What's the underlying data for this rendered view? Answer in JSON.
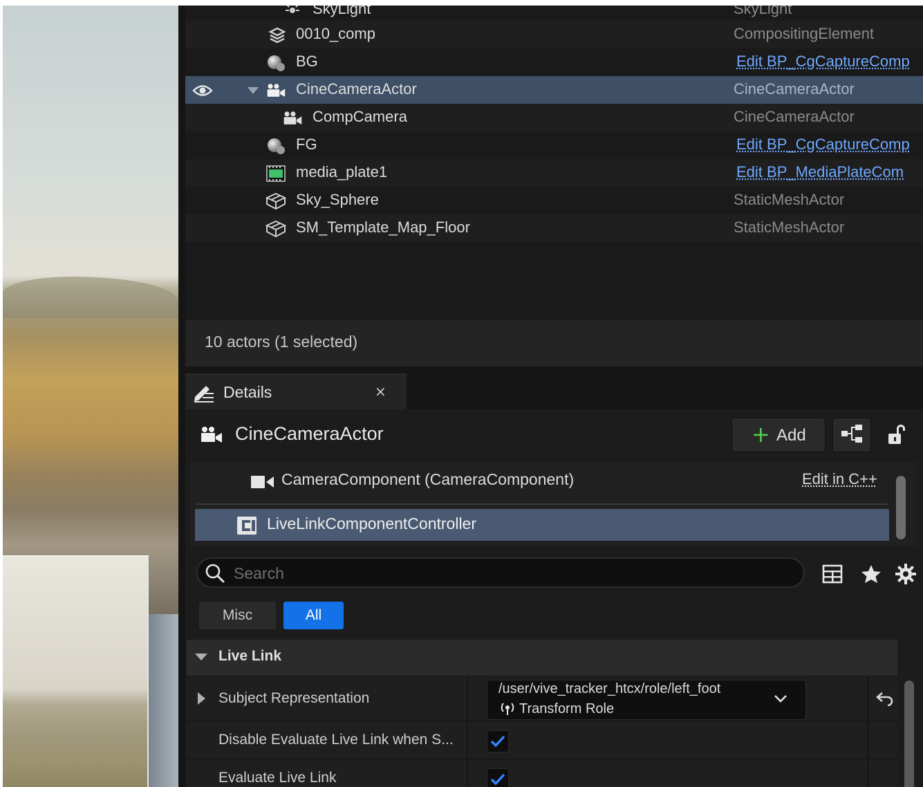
{
  "outliner": {
    "rows": [
      {
        "name": "SkyLight",
        "type": "SkyLight",
        "icon": "skylight-icon"
      },
      {
        "name": "0010_comp",
        "type": "CompositingElement",
        "icon": "layers-icon"
      },
      {
        "name": "BG",
        "type": "Edit BP_CgCaptureComp",
        "icon": "sphere-icon"
      },
      {
        "name": "CineCameraActor",
        "type": "CineCameraActor",
        "icon": "cine-camera-icon"
      },
      {
        "name": "CompCamera",
        "type": "CineCameraActor",
        "icon": "cine-camera-icon"
      },
      {
        "name": "FG",
        "type": "Edit BP_CgCaptureComp",
        "icon": "sphere-icon"
      },
      {
        "name": "media_plate1",
        "type": "Edit BP_MediaPlateCom",
        "icon": "media-plate-icon"
      },
      {
        "name": "Sky_Sphere",
        "type": "StaticMeshActor",
        "icon": "static-mesh-icon"
      },
      {
        "name": "SM_Template_Map_Floor",
        "type": "StaticMeshActor",
        "icon": "static-mesh-icon"
      }
    ],
    "status": "10 actors (1 selected)"
  },
  "details": {
    "tab_label": "Details",
    "tab_close": "×",
    "actor_name": "CineCameraActor",
    "add_label": "Add",
    "add_plus": "+",
    "components": {
      "camera": "CameraComponent (CameraComponent)",
      "edit_cpp": "Edit in C++",
      "controller": "LiveLinkComponentController"
    },
    "search_placeholder": "Search",
    "filters": {
      "misc": "Misc",
      "all": "All"
    },
    "category": "Live Link",
    "properties": {
      "subject_representation": {
        "label": "Subject Representation",
        "subject": "/user/vive_tracker_htcx/role/left_foot",
        "role": "Transform Role"
      },
      "disable_evaluate": {
        "label": "Disable Evaluate Live Link when S...",
        "checked": true
      },
      "evaluate": {
        "label": "Evaluate Live Link",
        "checked": true
      }
    }
  },
  "colors": {
    "accent": "#1472e8",
    "selection": "#3e4f66",
    "link": "#6fa8ff",
    "add_plus": "#4fcf4f"
  }
}
